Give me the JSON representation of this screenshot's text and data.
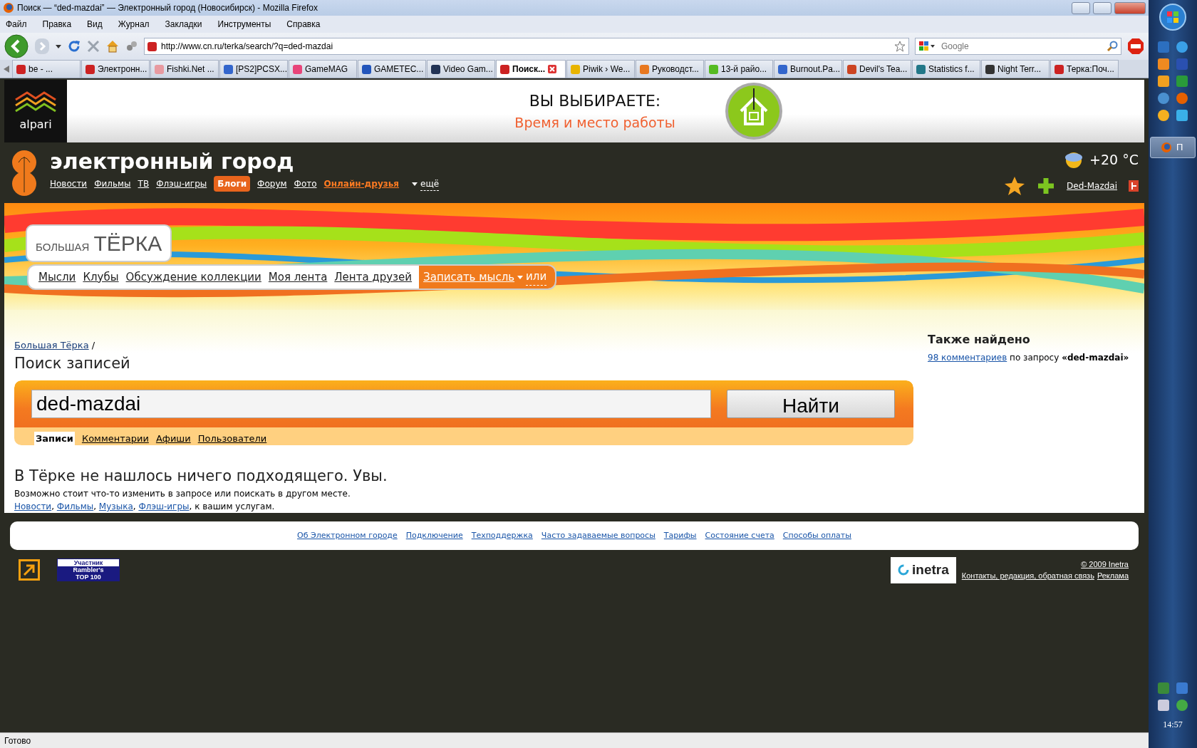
{
  "window": {
    "title": "Поиск — “ded-mazdai” — Электронный город (Новосибирск) - Mozilla Firefox"
  },
  "menu": [
    "Файл",
    "Правка",
    "Вид",
    "Журнал",
    "Закладки",
    "Инструменты",
    "Справка"
  ],
  "address": "http://www.cn.ru/terka/search/?q=ded-mazdai",
  "web_search": {
    "placeholder": "Google"
  },
  "tabs": [
    {
      "label": "be - ...",
      "selected": false,
      "color": "#cc2222"
    },
    {
      "label": "Электронн...",
      "selected": false,
      "color": "#cc2222"
    },
    {
      "label": "Fishki.Net ...",
      "selected": false,
      "color": "#e89aa0"
    },
    {
      "label": "[PS2]PCSX...",
      "selected": false,
      "color": "#3366cc"
    },
    {
      "label": "GameMAG",
      "selected": false,
      "color": "#e8457a"
    },
    {
      "label": "GAMETEC...",
      "selected": false,
      "color": "#2255bb"
    },
    {
      "label": "Video Gam...",
      "selected": false,
      "color": "#223355"
    },
    {
      "label": "Поиск...",
      "selected": true,
      "color": "#cc2222"
    },
    {
      "label": "Piwik › We...",
      "selected": false,
      "color": "#e8b400"
    },
    {
      "label": "Руководст...",
      "selected": false,
      "color": "#e87820"
    },
    {
      "label": "13-й райо...",
      "selected": false,
      "color": "#55bb22"
    },
    {
      "label": "Burnout.Pa...",
      "selected": false,
      "color": "#3366cc"
    },
    {
      "label": "Devil's Tea...",
      "selected": false,
      "color": "#cc4422"
    },
    {
      "label": "Statistics f...",
      "selected": false,
      "color": "#227788"
    },
    {
      "label": "Night Terr...",
      "selected": false,
      "color": "#333333"
    },
    {
      "label": "Терка:Поч...",
      "selected": false,
      "color": "#cc2222"
    }
  ],
  "ad": {
    "logo": "alpari",
    "headline": "ВЫ ВЫБИРАЕТЕ:",
    "tagline": "Время и место работы"
  },
  "site": {
    "title": "электронный город",
    "nav": [
      {
        "label": "Новости",
        "kind": "link"
      },
      {
        "label": "Фильмы",
        "kind": "link"
      },
      {
        "label": "ТВ",
        "kind": "link"
      },
      {
        "label": "Флэш-игры",
        "kind": "link"
      },
      {
        "label": "Блоги",
        "kind": "active"
      },
      {
        "label": "Форум",
        "kind": "link"
      },
      {
        "label": "Фото",
        "kind": "link"
      },
      {
        "label": "Онлайн-друзья",
        "kind": "highlight"
      },
      {
        "label": "ещё",
        "kind": "more"
      }
    ],
    "weather": "+20 °C",
    "user": "Ded-Mazdai"
  },
  "terka": {
    "logo_small": "БОЛЬШАЯ",
    "logo_big": "ТЁРКА",
    "nav": [
      "Мысли",
      "Клубы",
      "Обсуждение коллекции",
      "Моя лента",
      "Лента друзей"
    ],
    "write": "Записать мысль",
    "or": "или"
  },
  "breadcrumb": {
    "link": "Большая Тёрка",
    "separator": "/"
  },
  "heading": "Поиск записей",
  "search": {
    "value": "ded-mazdai",
    "button": "Найти",
    "scopes": [
      {
        "label": "Записи",
        "selected": true
      },
      {
        "label": "Комментарии",
        "selected": false
      },
      {
        "label": "Афиши",
        "selected": false
      },
      {
        "label": "Пользователи",
        "selected": false
      }
    ]
  },
  "empty": {
    "title": "В Тёрке не нашлось ничего подходящего. Увы.",
    "text": "Возможно стоит что-то изменить в запросе или поискать в другом месте.",
    "links": [
      "Новости",
      "Фильмы",
      "Музыка",
      "Флэш-игры"
    ],
    "separator": ",",
    "suffix": ", к вашим услугам."
  },
  "also": {
    "title": "Также найдено",
    "link": "98 комментариев",
    "text": "по запросу",
    "query": "«ded-mazdai»"
  },
  "footer_links": [
    "Об Электронном городе",
    "Подключение",
    "Техподдержка",
    "Часто задаваемые вопросы",
    "Тарифы",
    "Состояние счета",
    "Способы оплаты"
  ],
  "rambler": [
    "Участник",
    "Rambler's",
    "TOP 100"
  ],
  "inetra": "inetra",
  "copyright": "© 2009 Inetra",
  "contacts": "Контакты, редакция, обратная связь",
  "ads_link": "Реклама",
  "status": "Готово",
  "taskbar": {
    "task": "П",
    "clock": "14:57"
  }
}
